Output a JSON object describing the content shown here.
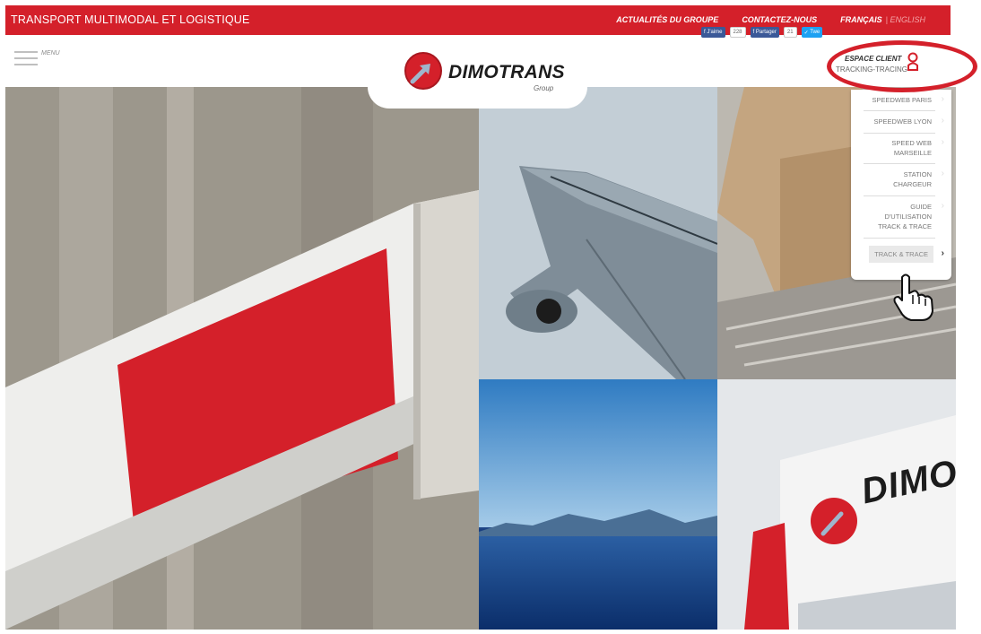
{
  "topbar": {
    "tagline": "TRANSPORT MULTIMODAL ET LOGISTIQUE",
    "links": [
      "ACTUALITÉS DU GROUPE",
      "CONTACTEZ-NOUS"
    ],
    "lang_active": "FRANÇAIS",
    "lang_alt": "| ENGLISH",
    "bg_color": "#d4202a"
  },
  "header": {
    "menu_label": "MENU",
    "logo_name": "DIMOTRANS",
    "logo_sub": "Group",
    "social": {
      "fb_label": "J'aime",
      "fb_count": "228",
      "share_label": "Partager",
      "share_count": "21",
      "tweet_label": "Twe"
    },
    "espace_client": {
      "title": "ESPACE CLIENT",
      "subtitle": "TRACKING-TRACING"
    }
  },
  "dropdown": {
    "items": [
      "SPEEDWEB PARIS",
      "SPEEDWEB LYON",
      "SPEED WEB MARSEILLE",
      "STATION CHARGEUR",
      "GUIDE D'UTILISATION TRACK & TRACE",
      "TRACK & TRACE"
    ],
    "active_item": "TRACK & TRACE"
  },
  "tiles": {
    "truck_text": "DIMOT"
  },
  "icons": [
    "hamburger-icon",
    "dimotrans-logo-icon",
    "facebook-icon",
    "twitter-icon",
    "user-icon",
    "chevron-right-icon",
    "hand-pointer-icon"
  ]
}
